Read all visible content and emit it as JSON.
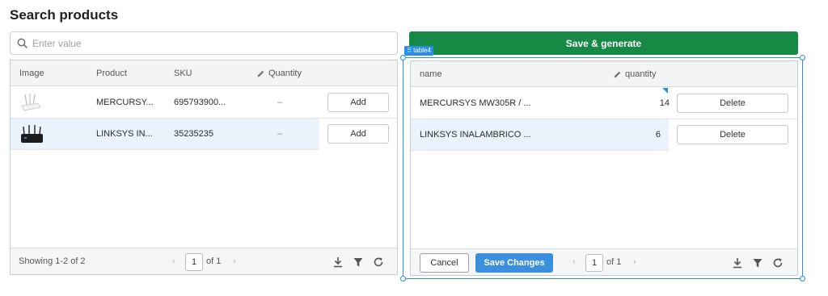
{
  "page": {
    "title": "Search products"
  },
  "search": {
    "placeholder": "Enter value",
    "value": ""
  },
  "actions": {
    "save_generate_label": "Save & generate"
  },
  "widget": {
    "tag_label": "table4"
  },
  "products_table": {
    "columns": {
      "image": "Image",
      "product": "Product",
      "sku": "SKU",
      "quantity": "Quantity"
    },
    "rows": [
      {
        "image_icon": "router-white-icon",
        "product": "MERCURSY...",
        "sku": "695793900...",
        "quantity": "–",
        "action_label": "Add"
      },
      {
        "image_icon": "router-black-icon",
        "product": "LINKSYS IN...",
        "sku": "35235235",
        "quantity": "–",
        "action_label": "Add"
      }
    ],
    "footer": {
      "showing": "Showing 1-2 of 2",
      "page": "1",
      "of_pages": "of 1"
    }
  },
  "cart_table": {
    "columns": {
      "name": "name",
      "quantity": "quantity"
    },
    "rows": [
      {
        "name": "MERCURSYS MW305R / ...",
        "quantity": "14",
        "action_label": "Delete",
        "edited": true
      },
      {
        "name": "LINKSYS INALAMBRICO ...",
        "quantity": "6",
        "action_label": "Delete",
        "edited": false
      }
    ],
    "footer": {
      "cancel_label": "Cancel",
      "save_changes_label": "Save Changes",
      "page": "1",
      "of_pages": "of 1"
    }
  },
  "colors": {
    "primary_green": "#168a45",
    "accent_blue": "#3c8fde",
    "selection_blue": "#2a8ee6"
  }
}
